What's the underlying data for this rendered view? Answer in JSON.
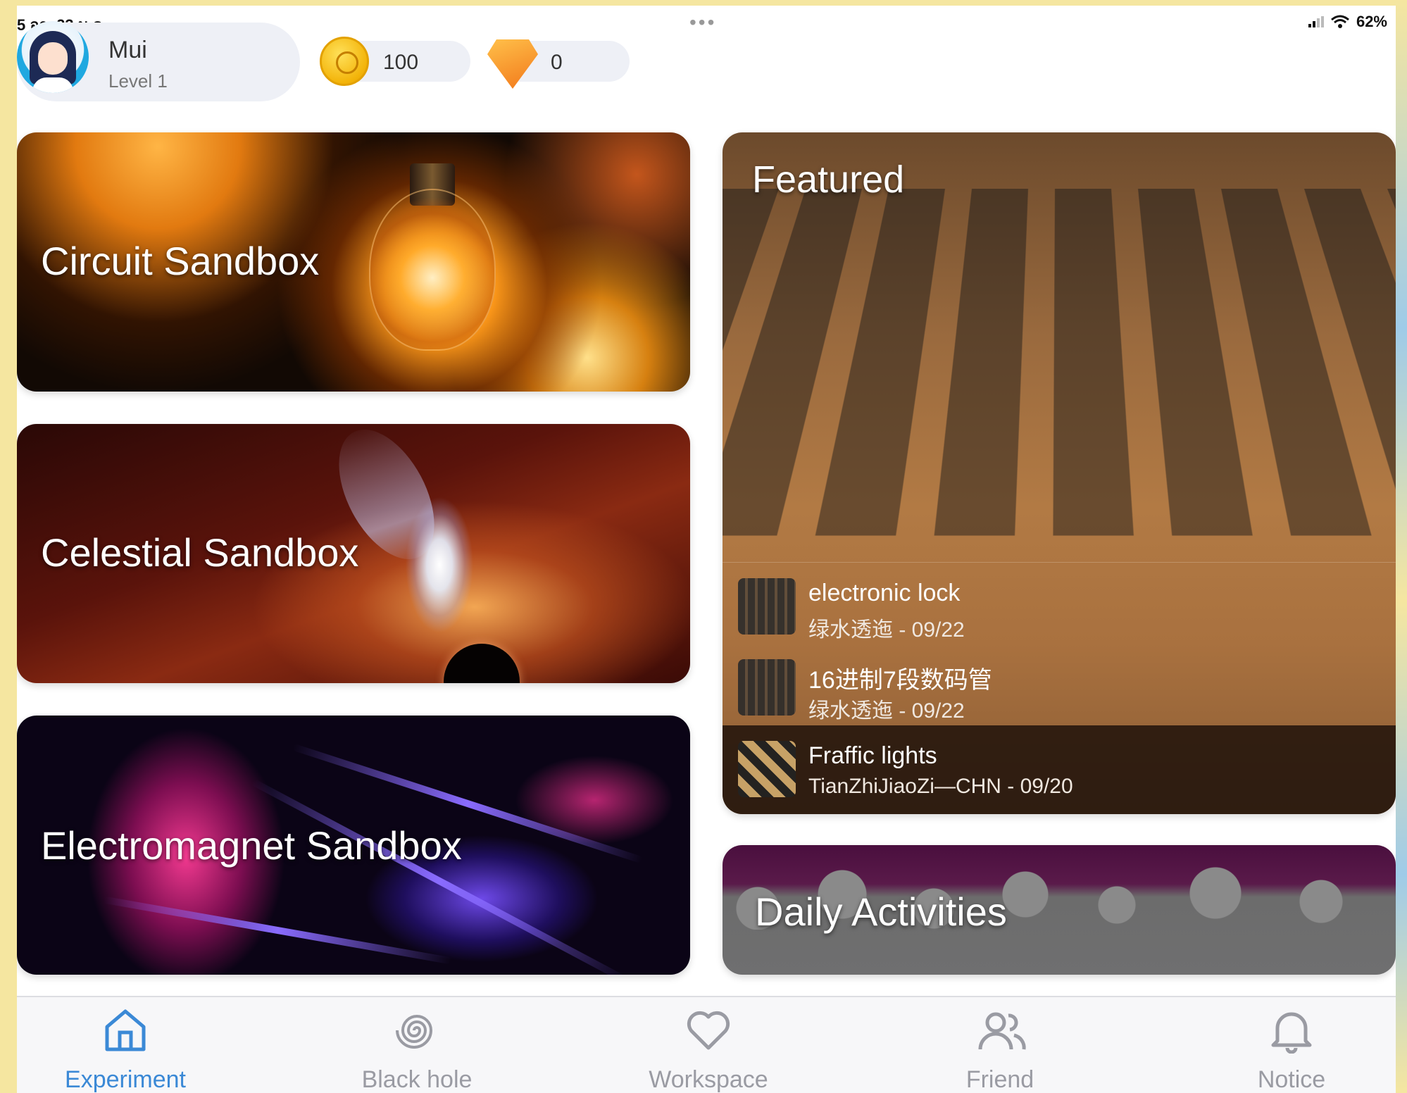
{
  "status_bar": {
    "time": "5 อา. 23 ม.ค.",
    "menu_dots": "•••",
    "battery": "62%"
  },
  "profile": {
    "name": "Mui",
    "level": "Level 1"
  },
  "currency": {
    "coins": "100",
    "gems": "0"
  },
  "cards": {
    "circuit": "Circuit Sandbox",
    "celestial": "Celestial Sandbox",
    "electromagnet": "Electromagnet Sandbox",
    "featured": "Featured",
    "daily": "Daily Activities"
  },
  "featured_items": [
    {
      "title": "electronic lock",
      "subtitle": "绿水透迤 - 09/22"
    },
    {
      "title": "16进制7段数码管",
      "subtitle": "绿水透迤 - 09/22"
    },
    {
      "title": "Fraffic lights",
      "subtitle": "TianZhiJiaoZi—CHN - 09/20"
    }
  ],
  "nav": [
    {
      "label": "Experiment",
      "icon": "home-icon",
      "active": true
    },
    {
      "label": "Black hole",
      "icon": "spiral-icon",
      "active": false
    },
    {
      "label": "Workspace",
      "icon": "heart-icon",
      "active": false
    },
    {
      "label": "Friend",
      "icon": "friends-icon",
      "active": false
    },
    {
      "label": "Notice",
      "icon": "bell-icon",
      "active": false
    }
  ],
  "colors": {
    "accent": "#3b89d6",
    "nav_inactive": "#9a9ba3",
    "coin": "#f3b40a",
    "gem": "#f2781a"
  }
}
